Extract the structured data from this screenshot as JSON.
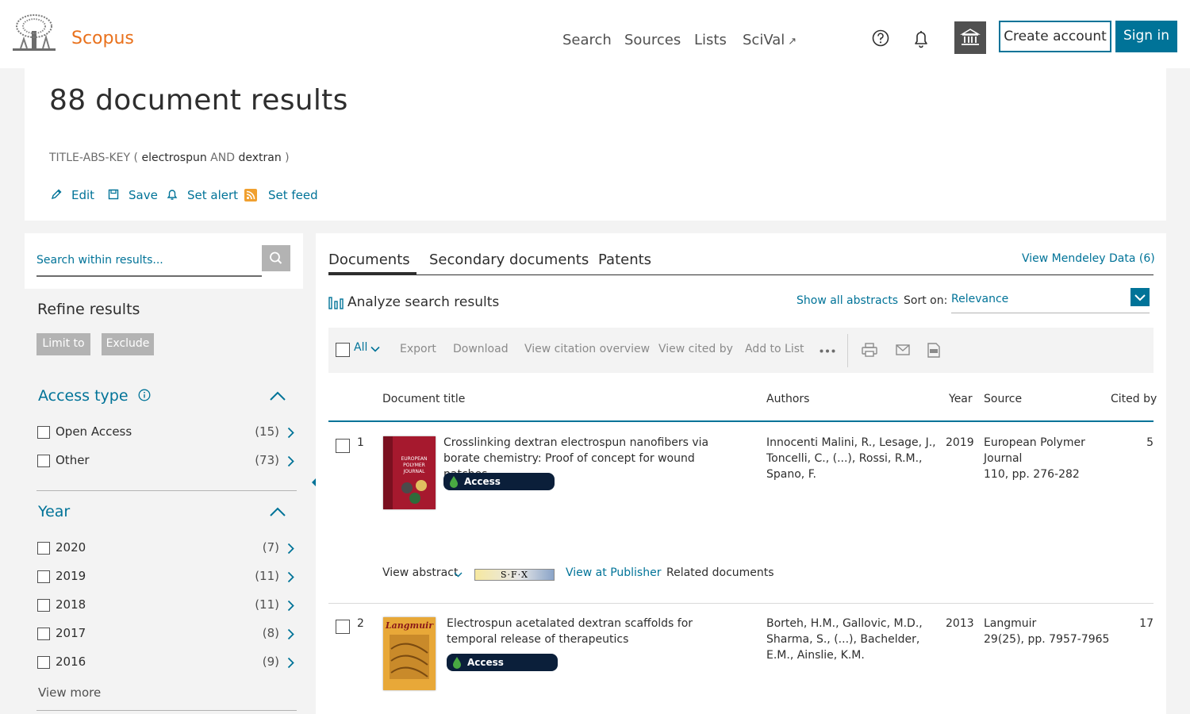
{
  "header": {
    "brand": "Scopus",
    "nav": [
      "Search",
      "Sources",
      "Lists",
      "SciVal"
    ],
    "scival_ext": "↗",
    "create_account": "Create account",
    "sign_in": "Sign in"
  },
  "results": {
    "title": "88 document results",
    "query": {
      "field": "TITLE-ABS-KEY",
      "open": "(",
      "term1": "electrospun",
      "op": "AND",
      "term2": "dextran",
      "close": ")"
    },
    "actions": [
      "Edit",
      "Save",
      "Set alert",
      "Set feed"
    ]
  },
  "sidebar": {
    "search_placeholder": "Search within results...",
    "refine_title": "Refine results",
    "limit_to": "Limit to",
    "exclude": "Exclude",
    "facets": [
      {
        "title": "Access type",
        "items": [
          {
            "label": "Open Access",
            "count": "(15)"
          },
          {
            "label": "Other",
            "count": "(73)"
          }
        ]
      },
      {
        "title": "Year",
        "items": [
          {
            "label": "2020",
            "count": "(7)"
          },
          {
            "label": "2019",
            "count": "(11)"
          },
          {
            "label": "2018",
            "count": "(11)"
          },
          {
            "label": "2017",
            "count": "(8)"
          },
          {
            "label": "2016",
            "count": "(9)"
          }
        ]
      }
    ],
    "view_more": "View more"
  },
  "main": {
    "tabs": [
      "Documents",
      "Secondary documents",
      "Patents"
    ],
    "mendeley": "View Mendeley Data (6)",
    "analyze": "Analyze search results",
    "show_abstracts": "Show all abstracts",
    "sort_label": "Sort on:",
    "sort_value": "Relevance",
    "toolbar": {
      "all": "All",
      "items": [
        "Export",
        "Download",
        "View citation overview",
        "View cited by",
        "Add to List"
      ]
    },
    "columns": [
      "Document title",
      "Authors",
      "Year",
      "Source",
      "Cited by"
    ],
    "results": [
      {
        "num": "1",
        "title": "Crosslinking dextran electrospun nanofibers via borate chemistry: Proof of concept for wound patches",
        "access": "Access Options...",
        "authors": "Innocenti Malini, R., Lesage, J., Toncelli, C., (...), Rossi, R.M., Spano, F.",
        "year": "2019",
        "source_name": "European Polymer Journal",
        "source_detail": "110, pp. 276-282",
        "cited": "5",
        "cover_text": [
          "EUROPEAN",
          "POLYMER",
          "JOURNAL"
        ]
      },
      {
        "num": "2",
        "title": "Electrospun acetalated dextran scaffolds for temporal release of therapeutics",
        "access": "Access Options...",
        "authors": "Borteh, H.M., Gallovic, M.D., Sharma, S., (...), Bachelder, E.M., Ainslie, K.M.",
        "year": "2013",
        "source_name": "Langmuir",
        "source_detail": "29(25), pp. 7957-7965",
        "cited": "17",
        "cover_text": [
          "Langmuir"
        ]
      }
    ],
    "view_abstract": "View abstract",
    "sfx": "S·F·X",
    "view_publisher": "View at Publisher",
    "related": "Related documents"
  },
  "colors": {
    "accent": "#007398",
    "brand": "#e9711c",
    "dark_button": "#505050",
    "access_button": "#0b1f3a"
  }
}
